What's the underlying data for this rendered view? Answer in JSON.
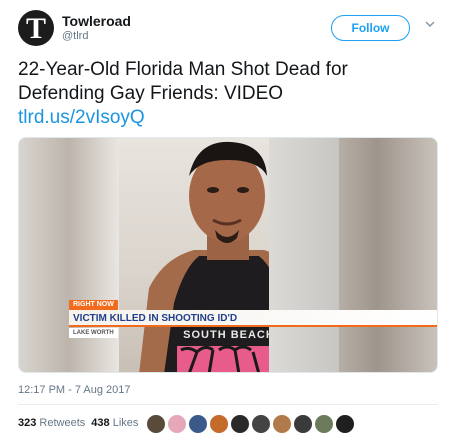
{
  "author": {
    "name": "Towleroad",
    "handle": "@tlrd",
    "avatar_letter": "T"
  },
  "follow_button": {
    "label": "Follow"
  },
  "tweet": {
    "text": "22-Year-Old Florida Man Shot Dead for Defending Gay Friends: VIDEO",
    "link": "tlrd.us/2vIsoyQ",
    "timestamp": "12:17 PM - 7 Aug 2017"
  },
  "media": {
    "shirt_text": "SOUTH BEACH",
    "news_tag": "RIGHT NOW",
    "headline": "VICTIM KILLED IN SHOOTING ID'D",
    "location": "LAKE WORTH"
  },
  "stats": {
    "retweets": "323",
    "retweets_label": "Retweets",
    "likes": "438",
    "likes_label": "Likes"
  },
  "likers": [
    {
      "name": "liker-1",
      "color": "#5a4a3a"
    },
    {
      "name": "liker-2",
      "color": "#e6a8b8"
    },
    {
      "name": "liker-3",
      "color": "#3b5a8c"
    },
    {
      "name": "liker-4",
      "color": "#c46a2a"
    },
    {
      "name": "liker-5",
      "color": "#2a2a2a"
    },
    {
      "name": "liker-6",
      "color": "#444444"
    },
    {
      "name": "liker-7",
      "color": "#b07a4a"
    },
    {
      "name": "liker-8",
      "color": "#3a3a3a"
    },
    {
      "name": "liker-9",
      "color": "#6a7a5a"
    },
    {
      "name": "liker-10",
      "color": "#1f1f1f"
    }
  ],
  "icons": {
    "caret": "chevron-down-icon"
  }
}
